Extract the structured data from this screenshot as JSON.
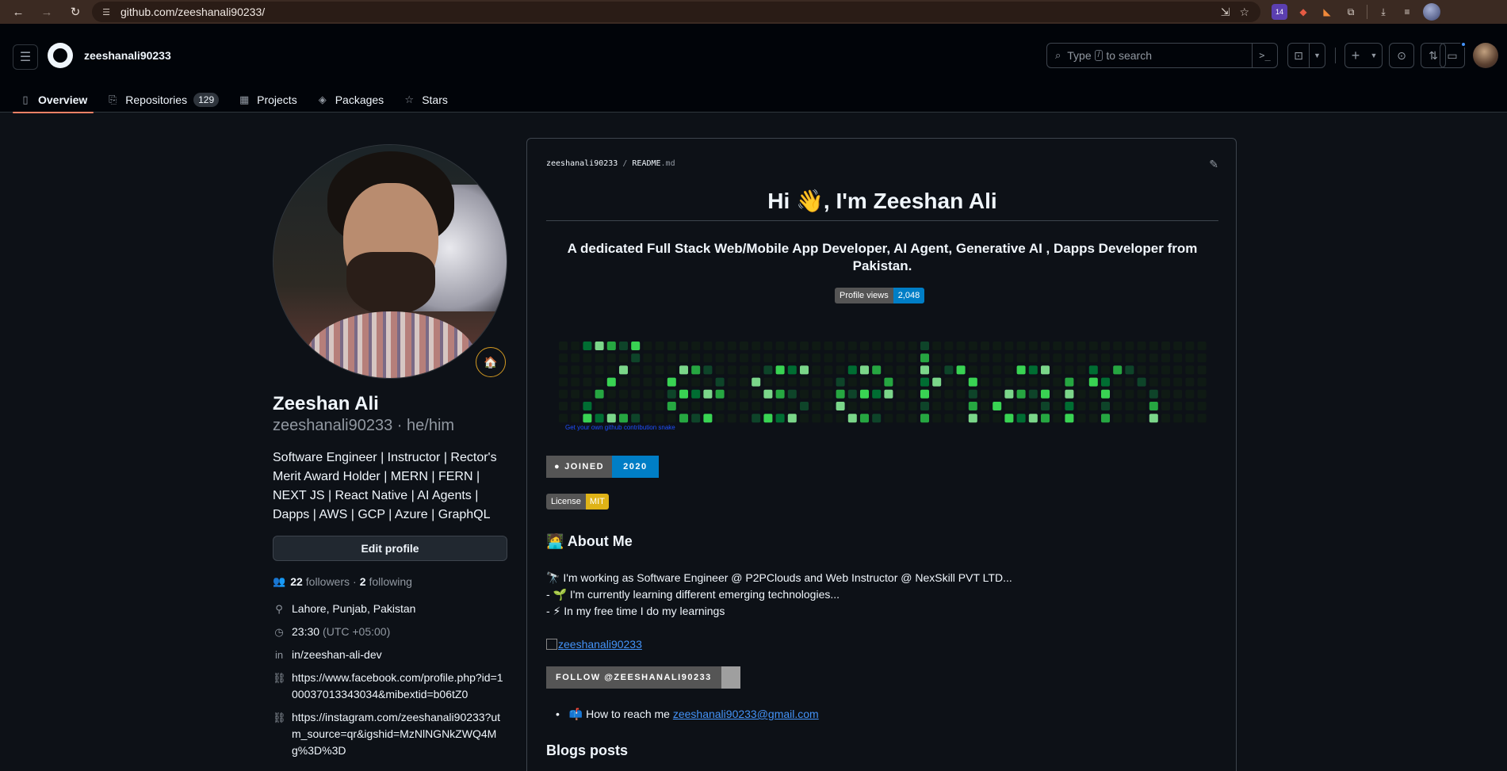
{
  "browser": {
    "url": "github.com/zeeshanali90233/",
    "ext_badge": "14"
  },
  "header": {
    "username": "zeeshanali90233",
    "search_text_before": "Type",
    "search_kbd": "/",
    "search_text_after": "to search",
    "cmd_label": ">_",
    "plus": "+"
  },
  "tabs": [
    {
      "label": "Overview",
      "icon": "book-icon"
    },
    {
      "label": "Repositories",
      "count": "129",
      "icon": "repo-icon"
    },
    {
      "label": "Projects",
      "icon": "table-icon"
    },
    {
      "label": "Packages",
      "icon": "package-icon"
    },
    {
      "label": "Stars",
      "icon": "star-icon"
    }
  ],
  "profile": {
    "status_emoji": "🏠",
    "name": "Zeeshan Ali",
    "login_line": "zeeshanali90233 · he/him",
    "bio": "Software Engineer | Instructor | Rector's Merit Award Holder | MERN | FERN | NEXT JS | React Native | AI Agents | Dapps | AWS | GCP | Azure | GraphQL",
    "edit_label": "Edit profile",
    "followers_count": "22",
    "followers_label": "followers",
    "dot": "·",
    "following_count": "2",
    "following_label": "following",
    "location": "Lahore, Punjab, Pakistan",
    "time": "23:30",
    "timezone": "(UTC +05:00)",
    "linkedin": "in/zeeshan-ali-dev",
    "facebook": "https://www.facebook.com/profile.php?id=100037013343034&mibextid=b06tZ0",
    "instagram": "https://instagram.com/zeeshanali90233?utm_source=qr&igshid=MzNlNGNkZWQ4Mg%3D%3D"
  },
  "readme": {
    "path_user": "zeeshanali90233",
    "path_sep": "/",
    "path_file": "README",
    "path_ext": ".md",
    "title": "Hi 👋, I'm Zeeshan Ali",
    "subtitle": "A dedicated Full Stack Web/Mobile App Developer, AI Agent, Generative AI , Dapps Developer from Pakistan.",
    "views_label": "Profile views",
    "views_value": "2,048",
    "snake_caption": "Get your own github contribution snake",
    "joined_label": "JOINED",
    "joined_year": "2020",
    "license_label": "License",
    "license_value": "MIT",
    "about_heading": "🧑‍💻 About Me",
    "about_lines": [
      "🔭 I'm working as Software Engineer @ P2PClouds and Web Instructor @ NexSkill PVT LTD...",
      "- 🌱 I'm currently learning different emerging technologies...",
      "- ⚡ In my free time I do my learnings"
    ],
    "broken_image_alt": "zeeshanali90233",
    "follow_badge": "FOLLOW @ZEESHANALI90233",
    "reach_text": "📫 How to reach me",
    "reach_email": "zeeshanali90233@gmail.com",
    "blogs_heading": "Blogs posts"
  },
  "colors": {
    "accent_tab": "#f78166",
    "link": "#4493f8",
    "bg": "#0d1117",
    "snake_levels": [
      "#0e4429",
      "#006d32",
      "#26a641",
      "#39d353",
      "#7bd68a"
    ]
  }
}
